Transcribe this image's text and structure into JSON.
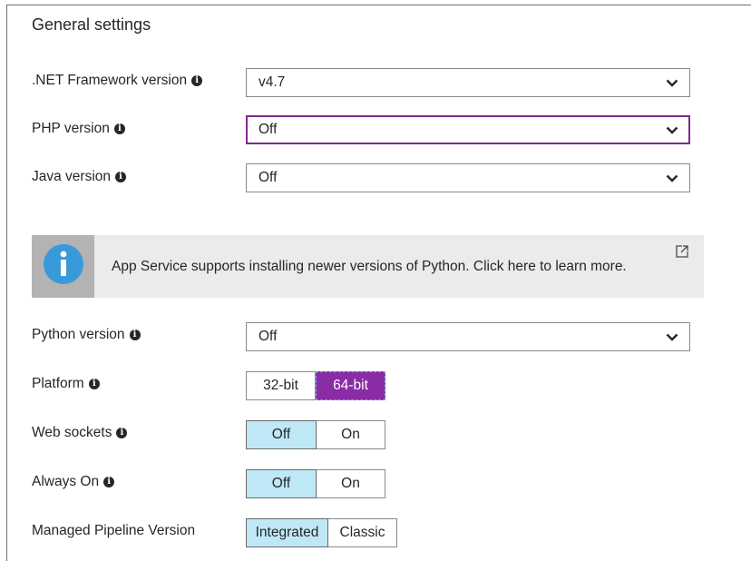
{
  "section_title": "General settings",
  "settings": {
    "dotnet": {
      "label": ".NET Framework version",
      "value": "v4.7"
    },
    "php": {
      "label": "PHP version",
      "value": "Off"
    },
    "java": {
      "label": "Java version",
      "value": "Off"
    },
    "python": {
      "label": "Python version",
      "value": "Off"
    }
  },
  "info_banner": {
    "icon": "info-circle-icon",
    "text": "App Service supports installing newer versions of Python. Click here to learn more.",
    "link_icon": "external-link-icon"
  },
  "toggles": {
    "platform": {
      "label": "Platform",
      "options": [
        "32-bit",
        "64-bit"
      ],
      "selected": "64-bit"
    },
    "web_sockets": {
      "label": "Web sockets",
      "options": [
        "Off",
        "On"
      ],
      "selected": "Off"
    },
    "always_on": {
      "label": "Always On",
      "options": [
        "Off",
        "On"
      ],
      "selected": "Off"
    },
    "managed_pipeline": {
      "label": "Managed Pipeline Version",
      "options": [
        "Integrated",
        "Classic"
      ],
      "selected": "Integrated"
    }
  },
  "colors": {
    "accent_purple": "#8a2ca5",
    "focus_border": "#7d2a8e",
    "selected_blue": "#bfe8f7",
    "info_blue": "#3a9ad9"
  }
}
